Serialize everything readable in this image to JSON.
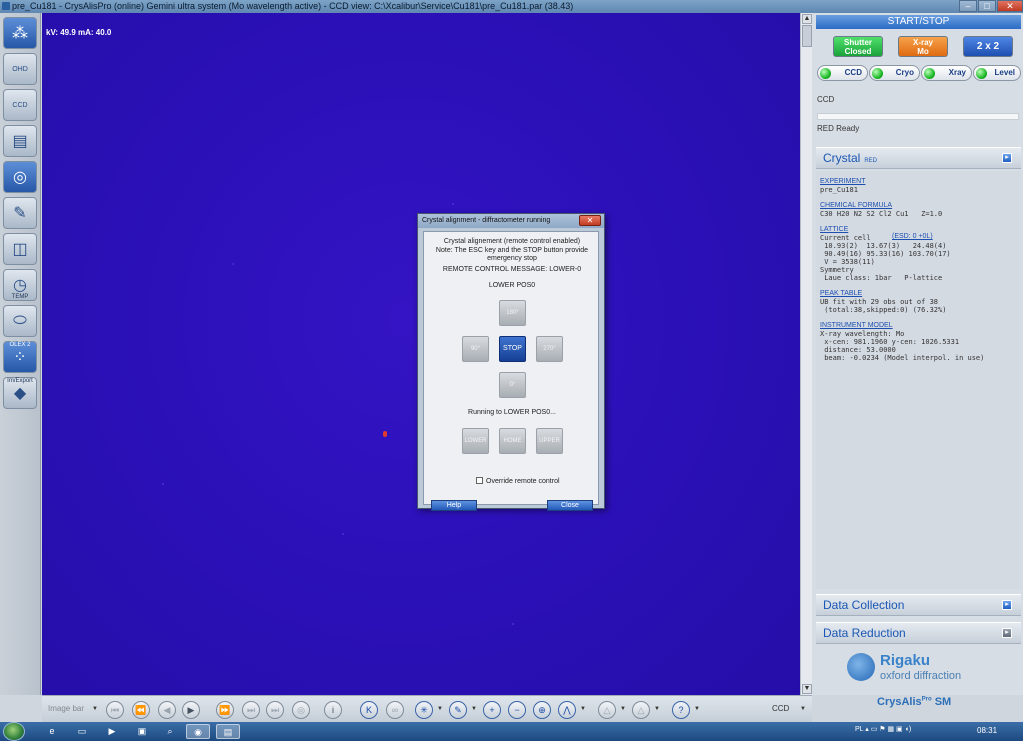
{
  "window": {
    "title": "pre_Cu181 - CrysAlisPro (online) Gemini ultra system (Mo wavelength active) - CCD view: C:\\Xcalibur\\Service\\Cu181\\pre_Cu181.par  (38.43)"
  },
  "left_toolbar": {
    "items": [
      {
        "name": "experiment-tool-icon",
        "label": ""
      },
      {
        "name": "ohd-tool-icon",
        "label": "OHD"
      },
      {
        "name": "ccd-tool-icon",
        "label": "CCD"
      },
      {
        "name": "notes-tool-icon",
        "label": ""
      },
      {
        "name": "view-tool-icon",
        "label": ""
      },
      {
        "name": "wrench-tool-icon",
        "label": ""
      },
      {
        "name": "diffraction-tool-icon",
        "label": ""
      },
      {
        "name": "clock-tool-icon",
        "label": "TEMP"
      },
      {
        "name": "cylinder-tool-icon",
        "label": ""
      },
      {
        "name": "olex2-tool-icon",
        "label": "OLEX 2"
      },
      {
        "name": "import-export-tool-icon",
        "label": "Im/Export"
      }
    ]
  },
  "ccd_view": {
    "kv_ma": "kV: 49.9 mA: 40.0"
  },
  "right_panel": {
    "start_stop": "START/STOP",
    "shutter_button": "Shutter\nClosed",
    "xray_button": "X-ray\nMo",
    "binning_button": "2 x 2",
    "status_items": [
      "CCD",
      "Cryo",
      "Xray",
      "Level"
    ],
    "ccd_label": "CCD",
    "ready_text": "RED  Ready",
    "crystal": {
      "title": "Crystal",
      "subtitle": "RED",
      "experiment_link": "EXPERIMENT",
      "experiment_value": "pre_Cu181",
      "formula_link": "CHEMICAL FORMULA",
      "formula_value": "C30 H20 N2 S2 Cl2 Cu1   Z=1.0",
      "lattice_link": "LATTICE",
      "current_cell": "Current cell",
      "esd_link": "(ESD: 0 +0L)",
      "cell_line1": " 10.93(2)  13.67(3)   24.48(4)",
      "cell_line2": " 90.49(16) 95.33(16) 103.70(17)",
      "cell_line3": " V = 3538(11)",
      "symmetry": "Symmetry",
      "laue": " Laue class: 1bar   P-lattice",
      "peak_link": "PEAK TABLE",
      "peak_line1": "UB fit with 29 obs out of 38",
      "peak_line2": " (total:38,skipped:0) (76.32%)",
      "instrument_link": "INSTRUMENT MODEL",
      "inst_line1": "X-ray wavelength: Mo",
      "inst_line2": " x-cen: 981.1960 y-cen: 1026.5331",
      "inst_line3": " distance: 53.0000",
      "inst_line4": " beam: -0.0234 (Model interpol. in use)"
    },
    "data_collection": "Data Collection",
    "data_reduction": "Data Reduction",
    "rigaku_line1": "Rigaku",
    "rigaku_line2": "oxford diffraction",
    "crysalis": "CrysAlis",
    "crysalis_sup": "Pro",
    "crysalis_suffix": "SM"
  },
  "bottom_toolbar": {
    "image_bar_label": "Image bar",
    "ccd_select": "CCD"
  },
  "taskbar": {
    "tray_text": "PL",
    "clock": "08:31"
  },
  "dialog": {
    "title": "Crystal alignment - diffractometer running",
    "close_glyph": "✕",
    "line1": "Crystal alignement (remote control enabled)",
    "line2": "Note: The ESC key and the STOP button provide",
    "line3": "emergency stop",
    "remote_message": "REMOTE CONTROL MESSAGE: LOWER-0",
    "position": "LOWER  POS0",
    "btn_180": "180°",
    "btn_90": "90°",
    "btn_stop": "STOP",
    "btn_270": "270°",
    "btn_0": "0°",
    "running": "Running to LOWER  POS0...",
    "btn_lower": "LOWER",
    "btn_home": "HOME",
    "btn_upper": "UPPER",
    "override": "Override remote control",
    "help": "Help",
    "close": "Close"
  }
}
